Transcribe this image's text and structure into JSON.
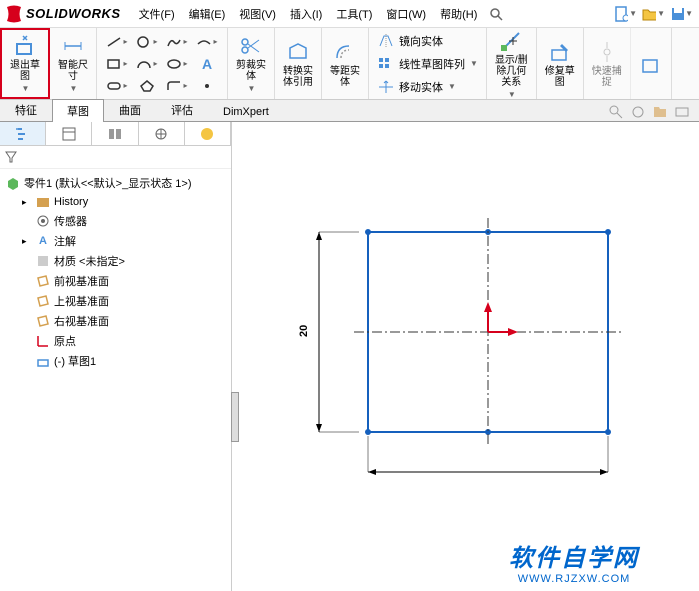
{
  "logo": {
    "text": "SOLIDWORKS"
  },
  "menu": {
    "items": [
      "文件(F)",
      "编辑(E)",
      "视图(V)",
      "插入(I)",
      "工具(T)",
      "窗口(W)",
      "帮助(H)"
    ]
  },
  "ribbon": {
    "exit_sketch": "退出草\n图",
    "smart_dim": "智能尺\n寸",
    "trim": "剪裁实\n体",
    "convert": "转换实\n体引用",
    "offset": "等距实\n体",
    "mirror": "镜向实体",
    "linear_pattern": "线性草图阵列",
    "move": "移动实体",
    "display_delete": "显示/删\n除几何\n关系",
    "repair": "修复草\n图",
    "quick_snap": "快速捕\n捉"
  },
  "tabs": {
    "items": [
      "特征",
      "草图",
      "曲面",
      "评估",
      "DimXpert"
    ],
    "active": 1
  },
  "tree": {
    "root": "零件1 (默认<<默认>_显示状态 1>)",
    "items": [
      {
        "label": "History",
        "icon": "history"
      },
      {
        "label": "传感器",
        "icon": "sensor"
      },
      {
        "label": "注解",
        "icon": "annotation"
      },
      {
        "label": "材质 <未指定>",
        "icon": "material"
      },
      {
        "label": "前视基准面",
        "icon": "plane"
      },
      {
        "label": "上视基准面",
        "icon": "plane"
      },
      {
        "label": "右视基准面",
        "icon": "plane"
      },
      {
        "label": "原点",
        "icon": "origin"
      }
    ],
    "sketch": "(-) 草图1"
  },
  "chart_data": {
    "type": "sketch",
    "dimension": 20,
    "shape": "rectangle",
    "construction_lines": [
      "horizontal-center",
      "vertical-center"
    ]
  },
  "watermark": {
    "title": "软件自学网",
    "url": "WWW.RJZXW.COM"
  }
}
